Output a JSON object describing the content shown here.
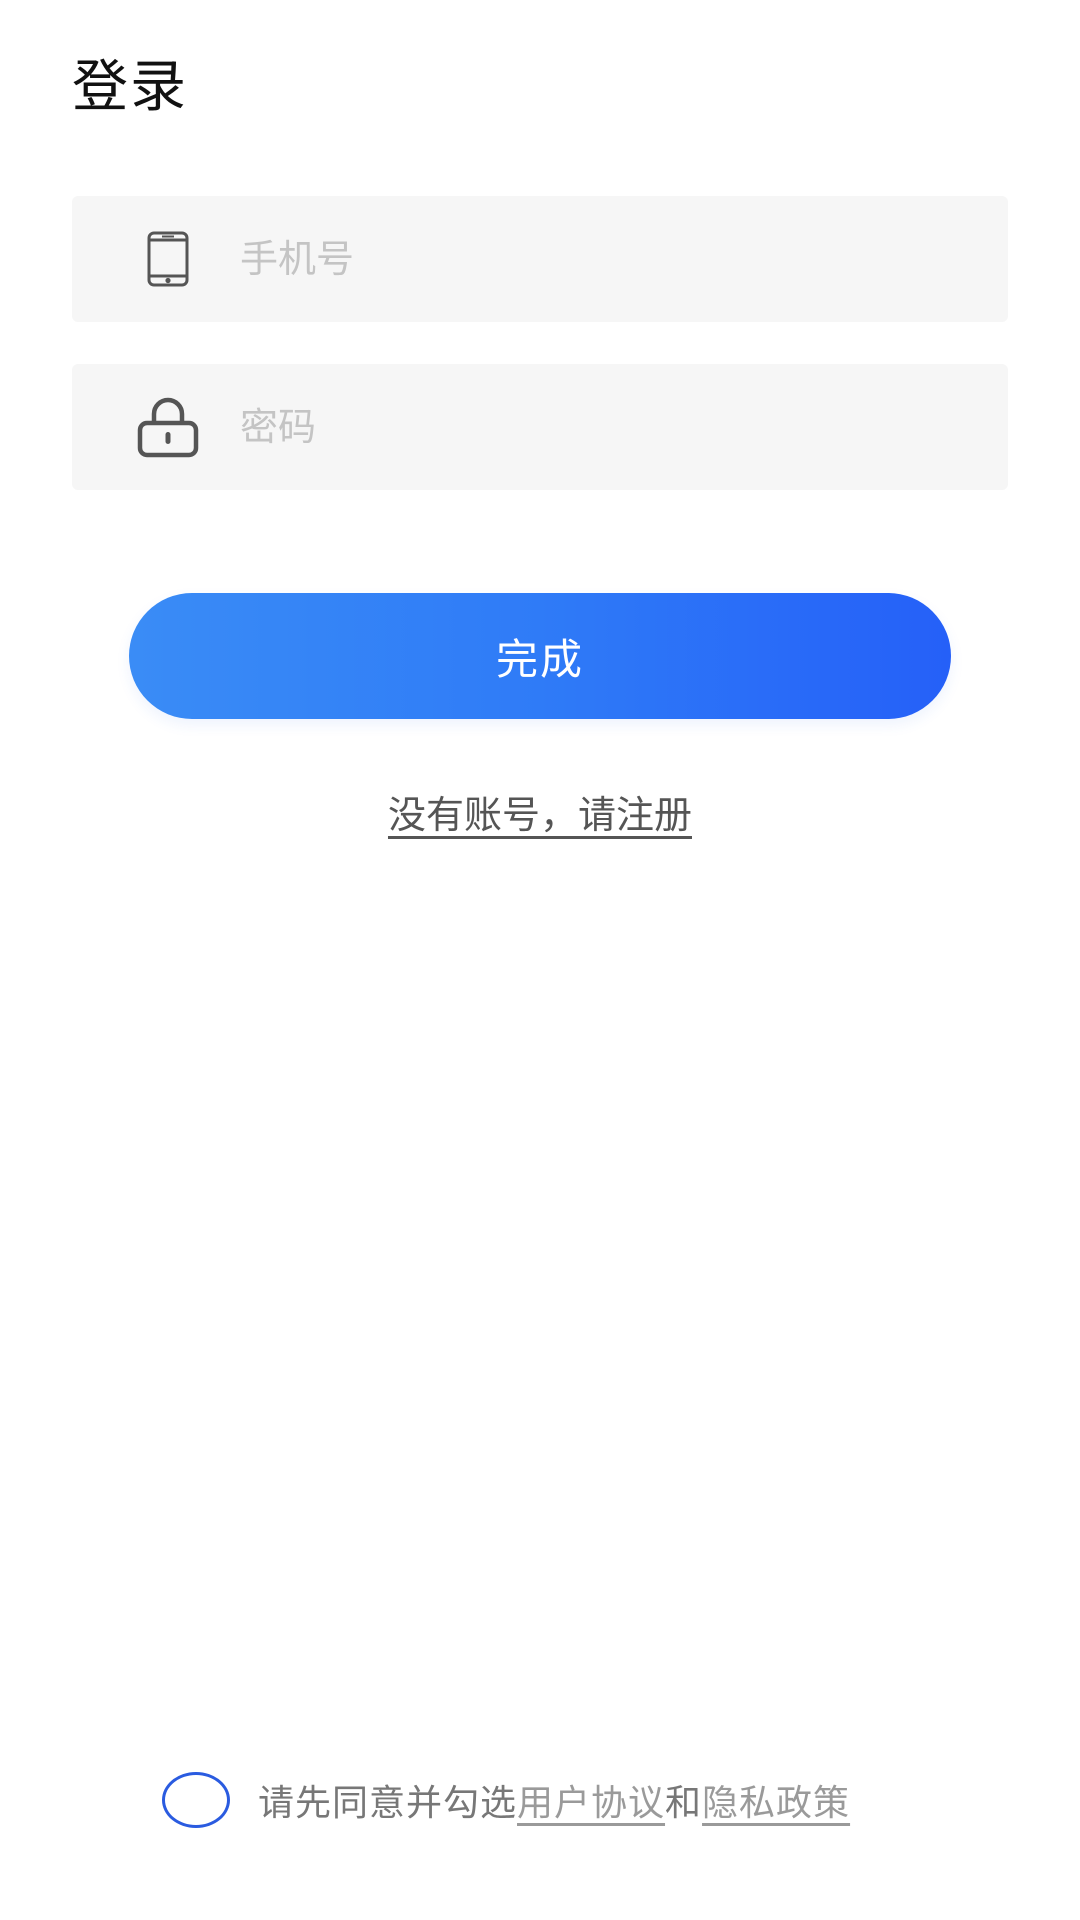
{
  "header": {
    "title": "登录"
  },
  "form": {
    "phone": {
      "icon": "phone-icon",
      "placeholder": "手机号",
      "value": ""
    },
    "password": {
      "icon": "lock-icon",
      "placeholder": "密码",
      "value": ""
    },
    "submit_label": "完成",
    "register_link": "没有账号，请注册"
  },
  "agreement": {
    "checked": false,
    "prefix": "请先同意并勾选",
    "user_agreement": "用户协议",
    "conjunction": "和",
    "privacy_policy": "隐私政策"
  },
  "colors": {
    "primary_start": "#3a8cf6",
    "primary_end": "#2560f8",
    "radio_border": "#2a5be0",
    "input_bg": "#f6f6f6"
  }
}
